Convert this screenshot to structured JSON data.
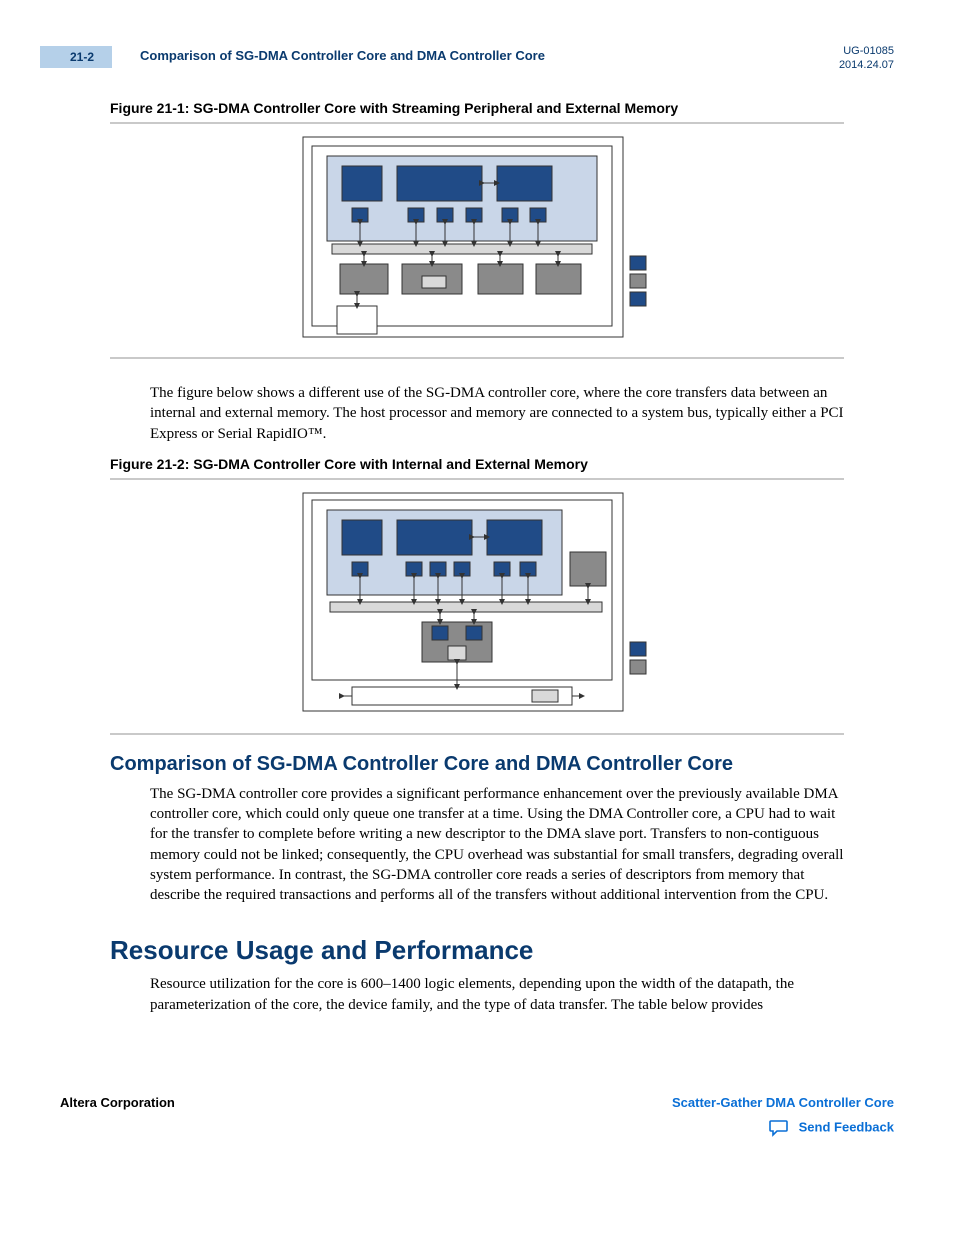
{
  "header": {
    "page_num": "21-2",
    "running_title": "Comparison of SG-DMA Controller Core and DMA Controller Core",
    "doc_id": "UG-01085",
    "date": "2014.24.07"
  },
  "figure1_caption": "Figure 21-1: SG-DMA Controller Core with Streaming Peripheral and External Memory",
  "paragraph1": "The figure below shows a different use of the SG-DMA controller core, where the core transfers data between an internal and external memory. The host processor and memory are connected to a system bus, typically either a PCI Express or Serial RapidIO™.",
  "figure2_caption": "Figure 21-2: SG-DMA Controller Core with Internal and External Memory",
  "section1_title": "Comparison of SG-DMA Controller Core and DMA Controller Core",
  "section1_body": "The SG-DMA controller core provides a significant performance enhancement over the previously available DMA controller core, which could only queue one transfer at a time. Using the DMA Controller core, a CPU had to wait for the transfer to complete before writing a new descriptor to the DMA slave port. Transfers to non-contiguous memory could not be linked; consequently, the CPU overhead was substantial for small transfers, degrading overall system performance. In contrast, the SG-DMA controller core reads a series of descriptors from memory that describe the required transactions and performs all of the transfers without additional intervention from the CPU.",
  "section2_title": "Resource Usage and Performance",
  "section2_body": "Resource utilization for the core is 600–1400 logic elements, depending upon the width of the datapath, the parameterization of the core, the device family, and the type of data transfer. The table below provides",
  "footer": {
    "company": "Altera Corporation",
    "doc_link": "Scatter-Gather DMA Controller Core",
    "feedback": "Send Feedback"
  }
}
